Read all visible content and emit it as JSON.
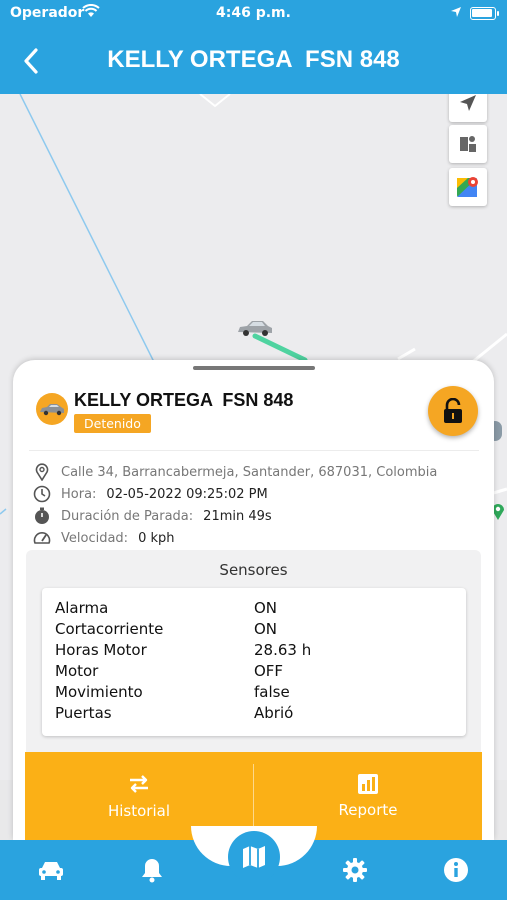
{
  "status_bar": {
    "carrier": "Operador",
    "time": "4:46 p.m."
  },
  "header": {
    "title": "KELLY ORTEGA  FSN 848"
  },
  "card": {
    "vehicle_name": "KELLY ORTEGA  FSN 848",
    "status": "Detenido",
    "address": "Calle 34, Barrancabermeja, Santander, 687031, Colombia",
    "hora": {
      "label": "Hora:",
      "value": "02-05-2022 09:25:02 PM"
    },
    "duracion": {
      "label": "Duración de Parada:",
      "value": "21min 49s"
    },
    "velocidad": {
      "label": "Velocidad:",
      "value": "0 kph"
    }
  },
  "sensors": {
    "title": "Sensores",
    "rows": [
      {
        "name": "Alarma",
        "value": "ON"
      },
      {
        "name": "Cortacorriente",
        "value": "ON"
      },
      {
        "name": "Horas Motor",
        "value": "28.63 h"
      },
      {
        "name": "Motor",
        "value": "OFF"
      },
      {
        "name": "Movimiento",
        "value": "false"
      },
      {
        "name": "Puertas",
        "value": "Abrió"
      }
    ]
  },
  "actions": {
    "historial": "Historial",
    "reporte": "Reporte"
  },
  "colors": {
    "primary": "#2aa3df",
    "accent": "#fbb016",
    "route": "#4fd3a0"
  },
  "icons": {
    "nav": [
      "car-icon",
      "bell-icon",
      "map-icon",
      "gear-icon",
      "info-icon"
    ],
    "info": [
      "location-pin-icon",
      "clock-icon",
      "stopwatch-icon",
      "speedometer-icon"
    ]
  }
}
